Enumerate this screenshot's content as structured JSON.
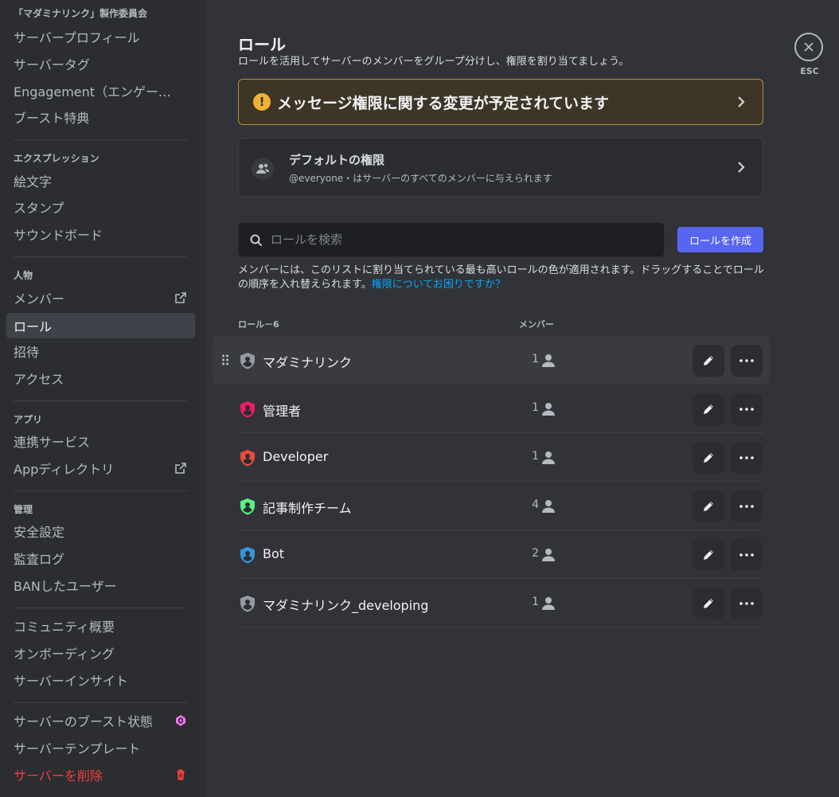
{
  "sidebar": {
    "server_name": "「マダミナリンク」製作委員会",
    "group1": [
      "サーバープロフィール",
      "サーバータグ",
      "Engagement（エンゲージメント）",
      "ブースト特典"
    ],
    "sec_expr": "エクスプレッション",
    "group2": [
      "絵文字",
      "スタンプ",
      "サウンドボード"
    ],
    "sec_people": "人物",
    "group3": [
      "メンバー",
      "ロール",
      "招待",
      "アクセス"
    ],
    "sec_apps": "アプリ",
    "group4": [
      "連携サービス",
      "Appディレクトリ"
    ],
    "sec_manage": "管理",
    "group5": [
      "安全設定",
      "監査ログ",
      "BANしたユーザー"
    ],
    "group6": [
      "コミュニティ概要",
      "オンボーディング",
      "サーバーインサイト"
    ],
    "group7": [
      "サーバーのブースト状態",
      "サーバーテンプレート",
      "サーバーを削除"
    ]
  },
  "main": {
    "title": "ロール",
    "subtitle": "ロールを活用してサーバーのメンバーをグループ分けし、権限を割り当てましょう。",
    "notice": "メッセージ権限に関する変更が予定されています",
    "default_title": "デフォルトの権限",
    "default_desc": "@everyone・はサーバーのすべてのメンバーに与えられます",
    "search_placeholder": "ロールを検索",
    "create_label": "ロールを作成",
    "hint": "メンバーには、このリストに割り当てられている最も高いロールの色が適用されます。ドラッグすることでロールの順序を入れ替えられます。",
    "hint_link": "権限についてお困りですか？",
    "col_roles": "ロール－6",
    "col_members": "メンバー",
    "roles": [
      {
        "name": "マダミナリンク",
        "count": "1",
        "color": "#949ba4"
      },
      {
        "name": "管理者",
        "count": "1",
        "color": "#e91e63"
      },
      {
        "name": "Developer",
        "count": "1",
        "color": "#e74c3c"
      },
      {
        "name": "記事制作チーム",
        "count": "4",
        "color": "#57f287"
      },
      {
        "name": "Bot",
        "count": "2",
        "color": "#3498db"
      },
      {
        "name": "マダミナリンク_developing",
        "count": "1",
        "color": "#949ba4"
      }
    ]
  },
  "close_label": "ESC",
  "colors": {
    "accent": "#5865f2",
    "warning": "#f0b232",
    "danger": "#f23f43",
    "boost": "#ff73fa"
  }
}
